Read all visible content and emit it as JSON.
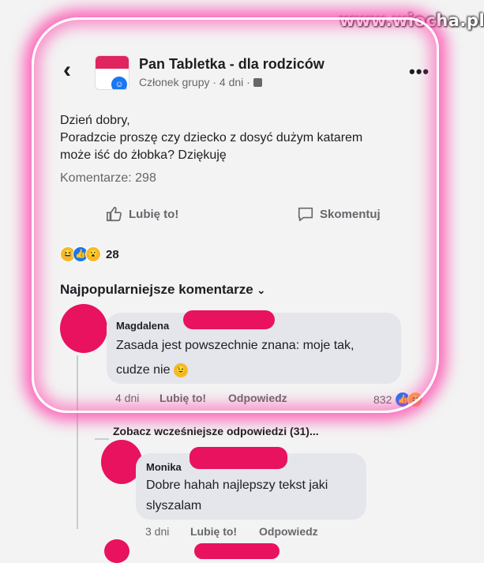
{
  "watermark": "www.wiocha.pl",
  "group": {
    "name": "Pan Tabletka - dla rodziców",
    "subtitle": "Członek grupy · 4 dni ·"
  },
  "post": {
    "lines": [
      "Dzień dobry,",
      "Poradzcie proszę czy dziecko z dosyć dużym katarem",
      "może iść do żłobka? Dziękuję"
    ],
    "comments_count": "Komentarze: 298",
    "like_label": "Lubię to!",
    "comment_label": "Skomentuj",
    "reactions_count": "28"
  },
  "comments_header": "Najpopularniejsze komentarze",
  "comments": [
    {
      "name": "Magdalena",
      "lines": [
        "Zasada jest powszechnie znana: moje tak,",
        "cudze nie"
      ],
      "time": "4 dni",
      "like": "Lubię to!",
      "reply": "Odpowiedz",
      "reactions": "832"
    },
    {
      "name": "Monika",
      "lines": [
        "Dobre hahah najlepszy tekst jaki",
        "slyszalam"
      ],
      "time": "3 dni",
      "like": "Lubię to!",
      "reply": "Odpowiedz"
    }
  ],
  "see_previous": "Zobacz wcześniejsze odpowiedzi (31)...",
  "colors": {
    "brand": "#1877f2",
    "redaction": "#e8125e",
    "glow": "#ff3caa"
  }
}
